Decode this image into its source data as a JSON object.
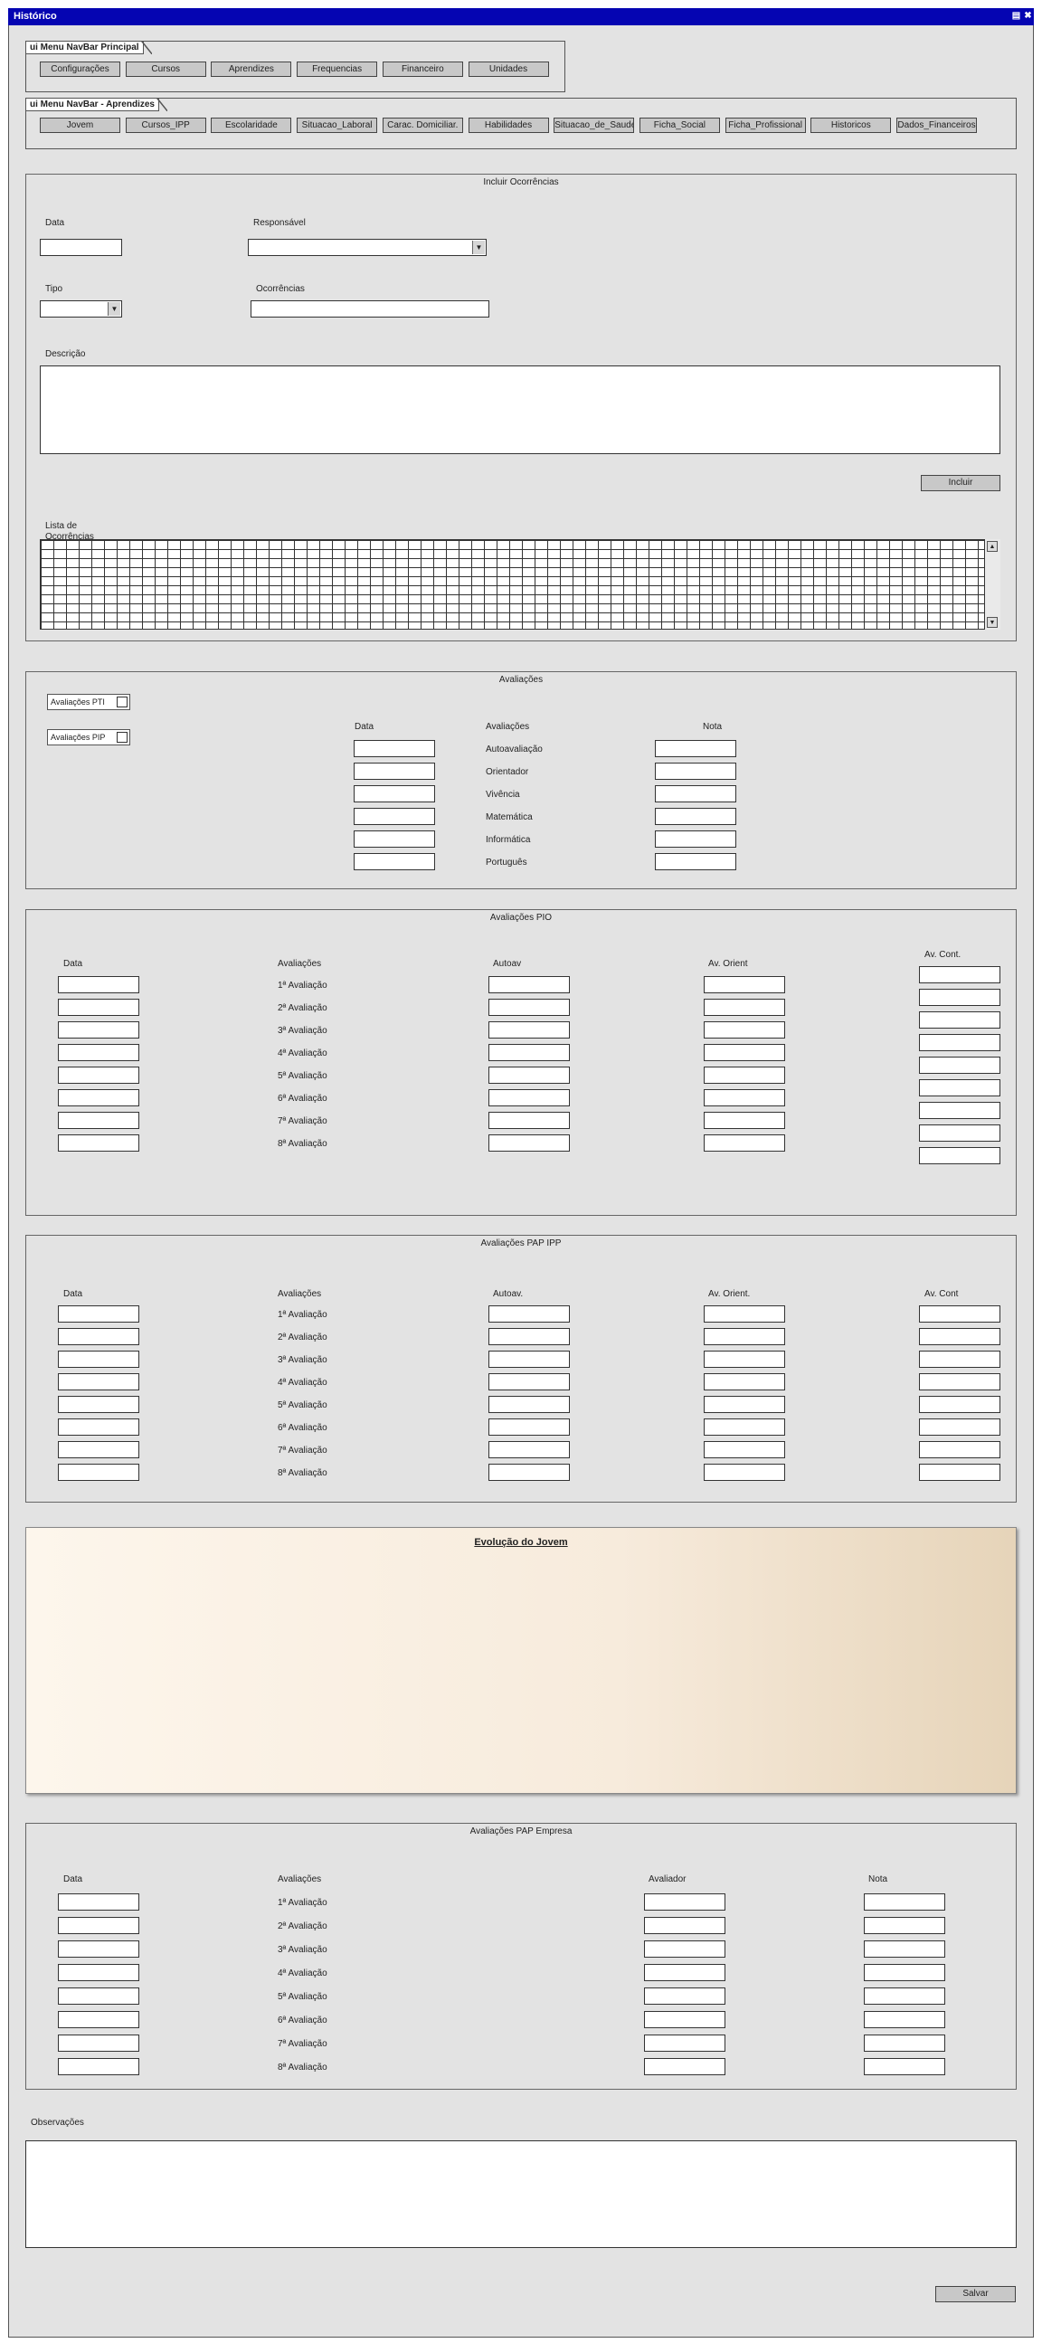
{
  "window": {
    "title": "Histórico"
  },
  "navbar_principal": {
    "title": "ui Menu NavBar Principal",
    "items": [
      "Configurações",
      "Cursos",
      "Aprendizes",
      "Frequencias",
      "Financeiro",
      "Unidades"
    ]
  },
  "navbar_aprendizes": {
    "title": "ui Menu NavBar - Aprendizes",
    "items": [
      "Jovem",
      "Cursos_IPP",
      "Escolaridade",
      "Situacao_Laboral",
      "Carac. Domiciliar.",
      "Habilidades",
      "Situacao_de_Saude",
      "Ficha_Social",
      "Ficha_Profissional",
      "Historicos",
      "Dados_Financeiros"
    ]
  },
  "ocorrencias": {
    "title": "Incluir Ocorrências",
    "data_label": "Data",
    "responsavel_label": "Responsável",
    "tipo_label": "Tipo",
    "ocorrencias_label": "Ocorrências",
    "descricao_label": "Descrição",
    "incluir_button": "Incluir",
    "lista_label": "Lista de Ocorrências"
  },
  "avaliacoes": {
    "title": "Avaliações",
    "checkboxes": [
      {
        "label": "Avaliações PTI"
      },
      {
        "label": "Avaliações PIP"
      }
    ],
    "col_data": "Data",
    "col_avaliacoes": "Avaliações",
    "col_nota": "Nota",
    "rows": [
      "Autoavaliação",
      "Orientador",
      "Vivência",
      "Matemática",
      "Informática",
      "Português"
    ]
  },
  "pio": {
    "title": "Avaliações PIO",
    "cols": [
      "Data",
      "Avaliações",
      "Autoav",
      "Av. Orient",
      "Av. Cont."
    ],
    "rows": [
      "1ª Avaliação",
      "2ª Avaliação",
      "3ª Avaliação",
      "4ª Avaliação",
      "5ª Avaliação",
      "6ª Avaliação",
      "7ª Avaliação",
      "8ª Avaliação"
    ]
  },
  "pap_ipp": {
    "title": "Avaliações PAP IPP",
    "cols": [
      "Data",
      "Avaliações",
      "Autoav.",
      "Av. Orient.",
      "Av. Cont"
    ],
    "rows": [
      "1ª Avaliação",
      "2ª Avaliação",
      "3ª Avaliação",
      "4ª Avaliação",
      "5ª Avaliação",
      "6ª Avaliação",
      "7ª Avaliação",
      "8ª Avaliação"
    ]
  },
  "evolucao": {
    "title": "Evolução do Jovem"
  },
  "pap_empresa": {
    "title": "Avaliações PAP Empresa",
    "cols": [
      "Data",
      "Avaliações",
      "Avaliador",
      "Nota"
    ],
    "rows": [
      "1ª Avaliação",
      "2ª Avaliação",
      "3ª Avaliação",
      "4ª Avaliação",
      "5ª Avaliação",
      "6ª Avaliação",
      "7ª Avaliação",
      "8ª Avaliação"
    ]
  },
  "observacoes": {
    "label": "Observações"
  },
  "salvar_button": "Salvar",
  "colors": {
    "titlebar": "#0505b2",
    "window_bg": "#e3e3e3",
    "evolucao_end": "#e6d4b9"
  },
  "icons": {
    "titlebar": [
      "maximize-icon",
      "close-icon"
    ],
    "dropdown": "chevron-down-icon",
    "scroll": [
      "scroll-up-icon",
      "scroll-down-icon"
    ]
  }
}
